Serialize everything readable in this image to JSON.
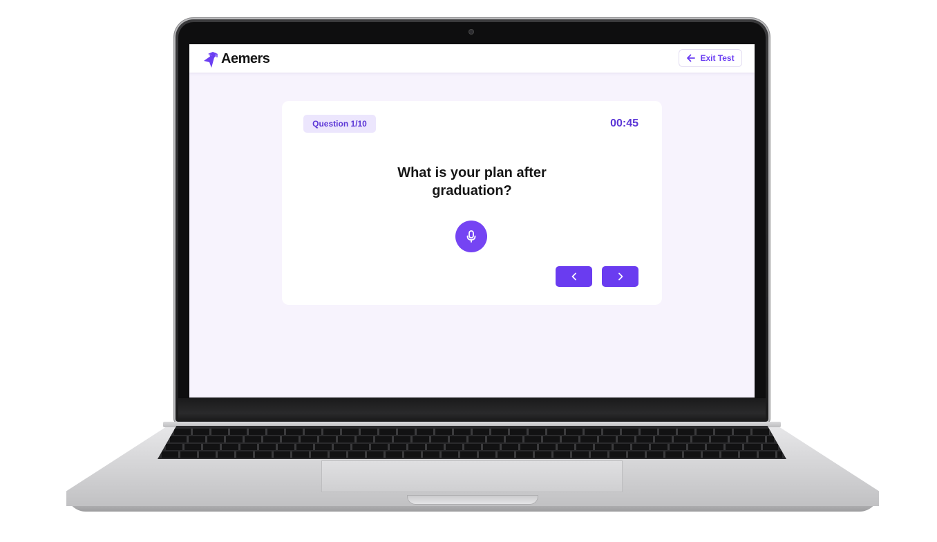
{
  "app": {
    "brand_name": "Aemers",
    "brand_color": "#6b3ef2"
  },
  "header": {
    "exit_label": "Exit Test",
    "exit_icon": "arrow-left-icon"
  },
  "quiz": {
    "question_badge": "Question 1/10",
    "timer": "00:45",
    "question_text": "What is your plan after graduation?",
    "mic_icon": "microphone-icon",
    "prev_icon": "chevron-left-icon",
    "next_icon": "chevron-right-icon"
  }
}
